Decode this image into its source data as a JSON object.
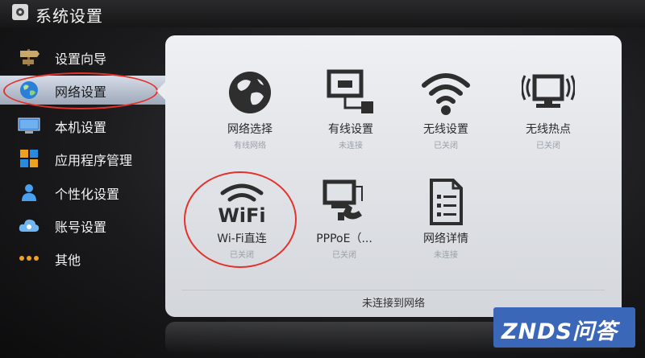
{
  "title": "系统设置",
  "sidebar": {
    "items": [
      {
        "label": "设置向导",
        "icon": "signpost-icon"
      },
      {
        "label": "网络设置",
        "icon": "globe-icon",
        "active": true
      },
      {
        "label": "本机设置",
        "icon": "monitor-icon"
      },
      {
        "label": "应用程序管理",
        "icon": "app-grid-icon"
      },
      {
        "label": "个性化设置",
        "icon": "person-icon"
      },
      {
        "label": "账号设置",
        "icon": "cloud-account-icon"
      },
      {
        "label": "其他",
        "icon": "more-dots-icon"
      }
    ]
  },
  "tiles": [
    {
      "label": "网络选择",
      "status": "有线网络",
      "icon": "globe-icon"
    },
    {
      "label": "有线设置",
      "status": "未连接",
      "icon": "wired-network-icon"
    },
    {
      "label": "无线设置",
      "status": "已关闭",
      "icon": "wifi-icon"
    },
    {
      "label": "无线热点",
      "status": "已关闭",
      "icon": "hotspot-icon"
    },
    {
      "label": "Wi-Fi直连",
      "status": "已关闭",
      "icon": "wifi-direct-icon",
      "icon_text": "WiFi"
    },
    {
      "label": "PPPoE（...",
      "status": "已关闭",
      "icon": "pppoe-icon"
    },
    {
      "label": "网络详情",
      "status": "未连接",
      "icon": "network-details-icon"
    }
  ],
  "status_bar": "未连接到网络",
  "watermark": "ZNDS问答",
  "colors": {
    "highlight": "#e5312b",
    "panel": "#e4e6ea",
    "watermark_bg": "#3b67b8"
  }
}
